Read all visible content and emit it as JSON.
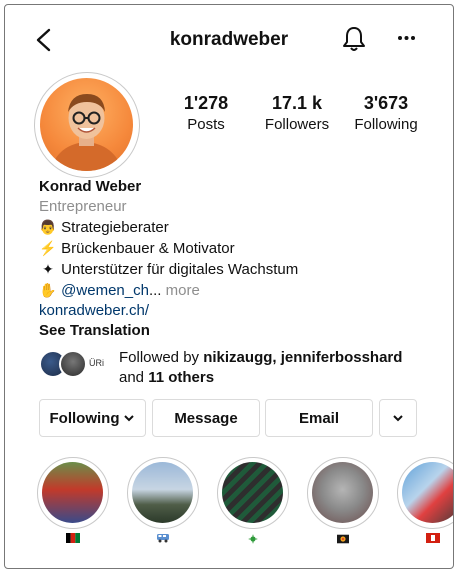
{
  "header": {
    "username": "konradweber"
  },
  "stats": [
    {
      "value": "1'278",
      "label": "Posts"
    },
    {
      "value": "17.1 k",
      "label": "Followers"
    },
    {
      "value": "3'673",
      "label": "Following"
    }
  ],
  "bio": {
    "name": "Konrad Weber",
    "category": "Entrepreneur",
    "line1": "Strategieberater",
    "line2": "Brückenbauer & Motivator",
    "line3": "Unterstützer für digitales Wachstum",
    "mention": "@wemen_ch",
    "ellipsis": "...",
    "more": "more",
    "website": "konradweber.ch/",
    "translate": "See Translation"
  },
  "followed_by": {
    "prefix": "Followed by ",
    "names": "nikizaugg, jenniferbosshard",
    "and": "and ",
    "others": "11 others",
    "avatar_tag": "ÜRi"
  },
  "actions": {
    "following": "Following",
    "message": "Message",
    "email": "Email"
  },
  "stories": [
    {
      "icon": "afghanistan-flag-icon"
    },
    {
      "icon": "minibus-icon"
    },
    {
      "icon": "virus-icon"
    },
    {
      "icon": "fireworks-icon"
    },
    {
      "icon": "flag-icon"
    }
  ],
  "colors": {
    "link": "#00376b",
    "muted": "#8e8e8e",
    "border": "#dbdbdb"
  }
}
